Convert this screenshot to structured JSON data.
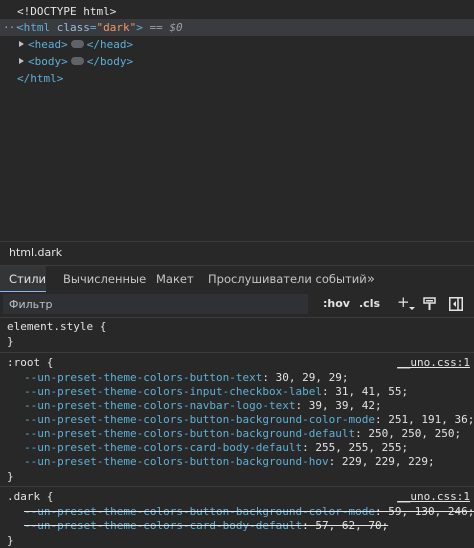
{
  "dom": {
    "doctype": "<!DOCTYPE html>",
    "html_open_tag": "<html",
    "html_attr_name": "class",
    "html_attr_value": "dark",
    "html_close_bracket": ">",
    "selected_marker": "== $0",
    "head_open": "<head>",
    "head_close": "</head>",
    "body_open": "<body>",
    "body_close": "</body>",
    "html_close": "</html>"
  },
  "breadcrumb": {
    "item": "html.dark"
  },
  "tabs": [
    {
      "label": "Стили"
    },
    {
      "label": "Вычисленные"
    },
    {
      "label": "Макет"
    },
    {
      "label": "Прослушиватели событий"
    },
    {
      "label": "»"
    }
  ],
  "filter": {
    "placeholder": "Фильтр",
    "hov": ":hov",
    "cls": ".cls",
    "add": "+"
  },
  "rules": {
    "element_style": {
      "selector": "element.style {",
      "close": "}"
    },
    "root": {
      "selector": ":root {",
      "source": "__uno.css:1",
      "close": "}",
      "props": [
        {
          "name": "--un-preset-theme-colors-button-text",
          "value": "30, 29, 29;"
        },
        {
          "name": "--un-preset-theme-colors-input-checkbox-label",
          "value": "31, 41, 55;"
        },
        {
          "name": "--un-preset-theme-colors-navbar-logo-text",
          "value": "39, 39, 42;"
        },
        {
          "name": "--un-preset-theme-colors-button-background-color-mode",
          "value": "251, 191, 36;"
        },
        {
          "name": "--un-preset-theme-colors-button-background-default",
          "value": "250, 250, 250;"
        },
        {
          "name": "--un-preset-theme-colors-card-body-default",
          "value": "255, 255, 255;"
        },
        {
          "name": "--un-preset-theme-colors-button-background-hov",
          "value": "229, 229, 229;"
        }
      ]
    },
    "dark": {
      "selector": ".dark {",
      "source": "__uno.css:1",
      "close": "}",
      "props": [
        {
          "name": "--un-preset-theme-colors-button-background-color-mode",
          "value": "59, 130, 246;"
        },
        {
          "name": "--un-preset-theme-colors-card-body-default",
          "value": "57, 62, 70;"
        }
      ]
    }
  },
  "colors": {
    "accent": "#8ab4f8",
    "tag": "#5db0d7",
    "attr_value": "#f29766"
  }
}
